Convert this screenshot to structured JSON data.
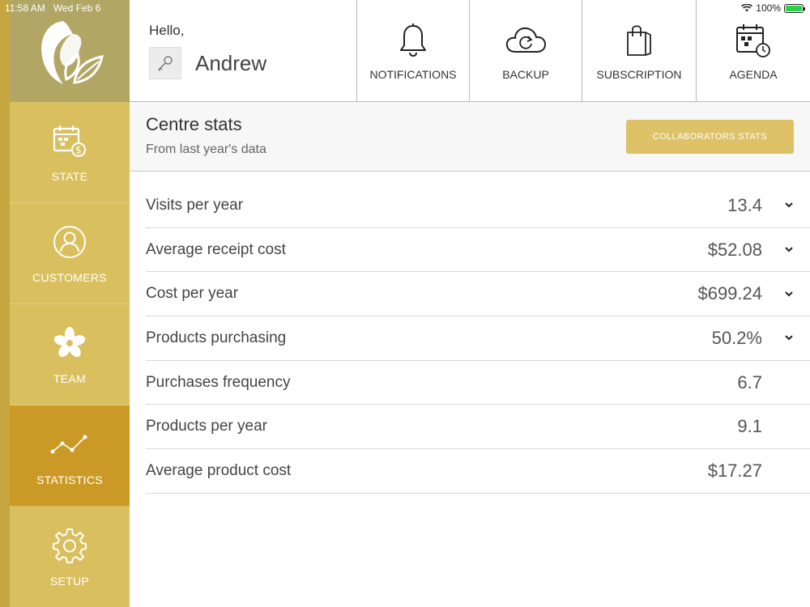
{
  "status_bar": {
    "time": "11:58 AM",
    "date": "Wed Feb 6",
    "battery": "100%"
  },
  "sidebar": {
    "logo_icon": "woman-leaf-logo",
    "items": [
      {
        "label": "STATE",
        "icon": "calendar-dollar-icon",
        "active": false
      },
      {
        "label": "CUSTOMERS",
        "icon": "person-circle-icon",
        "active": false
      },
      {
        "label": "TEAM",
        "icon": "flower-icon",
        "active": false
      },
      {
        "label": "STATISTICS",
        "icon": "line-chart-icon",
        "active": true
      },
      {
        "label": "SETUP",
        "icon": "gear-icon",
        "active": false
      }
    ]
  },
  "header": {
    "greeting": "Hello,",
    "user_name": "Andrew",
    "buttons": [
      {
        "label": "NOTIFICATIONS",
        "icon": "bell-icon"
      },
      {
        "label": "BACKUP",
        "icon": "cloud-sync-icon"
      },
      {
        "label": "SUBSCRIPTION",
        "icon": "shopping-bag-icon"
      },
      {
        "label": "AGENDA",
        "icon": "calendar-clock-icon"
      }
    ]
  },
  "section": {
    "title": "Centre stats",
    "subtitle": "From last year's data",
    "collab_button": "COLLABORATORS STATS"
  },
  "stats": [
    {
      "label": "Visits per year",
      "value": "13.4",
      "expandable": true
    },
    {
      "label": "Average receipt cost",
      "value": "$52.08",
      "expandable": true
    },
    {
      "label": "Cost per year",
      "value": "$699.24",
      "expandable": true
    },
    {
      "label": "Products purchasing",
      "value": "50.2%",
      "expandable": true
    },
    {
      "label": "Purchases frequency",
      "value": "6.7",
      "expandable": false
    },
    {
      "label": "Products per year",
      "value": "9.1",
      "expandable": false
    },
    {
      "label": "Average product cost",
      "value": "$17.27",
      "expandable": false
    }
  ],
  "colors": {
    "sidebar_bg": "#d9bf5e",
    "sidebar_active": "#cb9a26",
    "logo_bg": "#b1a664",
    "accent_button": "#ddc268"
  }
}
